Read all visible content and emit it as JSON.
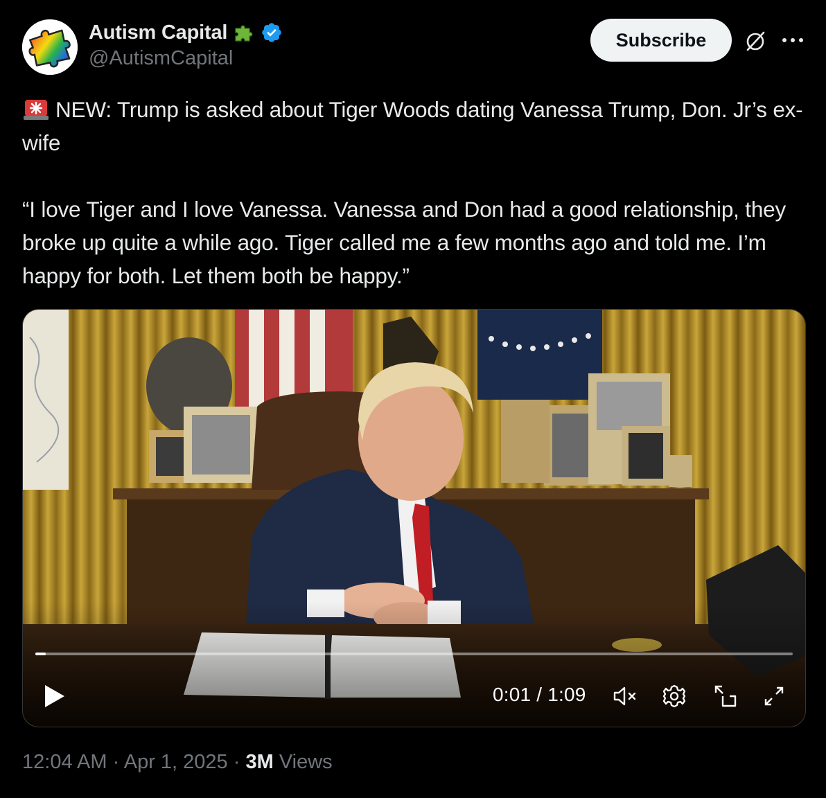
{
  "author": {
    "display_name": "Autism Capital",
    "handle": "@AutismCapital",
    "puzzle_emoji": "puzzle-piece-icon",
    "verified_badge": "verified-badge-icon",
    "badge_color": "#1d9bf0"
  },
  "header": {
    "subscribe_label": "Subscribe",
    "grok_icon": "grok-icon",
    "more_icon": "more-options-icon"
  },
  "tweet": {
    "line1": "NEW: Trump is asked about Tiger Woods dating Vanessa Trump, Don. Jr’s ex-wife",
    "quote": "“I love Tiger and I love Vanessa. Vanessa and Don had a good relationship, they broke up quite a while ago. Tiger called me a few months ago and told me. I’m happy for both. Let them both be happy.”",
    "leading_emoji": "police-siren-icon"
  },
  "video": {
    "current_time": "0:01",
    "duration": "1:09",
    "time_label": "0:01 / 1:09",
    "progress_fraction": 0.014,
    "controls": [
      "play-icon",
      "mute-icon",
      "settings-icon",
      "picture-in-picture-icon",
      "fullscreen-icon"
    ]
  },
  "meta": {
    "time": "12:04 AM",
    "date": "Apr 1, 2025",
    "views_count": "3M",
    "views_label": "Views",
    "separator": "·"
  },
  "colors": {
    "background": "#000000",
    "text": "#e7e9ea",
    "muted": "#71767b",
    "accent": "#1d9bf0",
    "button_bg": "#eff3f4"
  }
}
